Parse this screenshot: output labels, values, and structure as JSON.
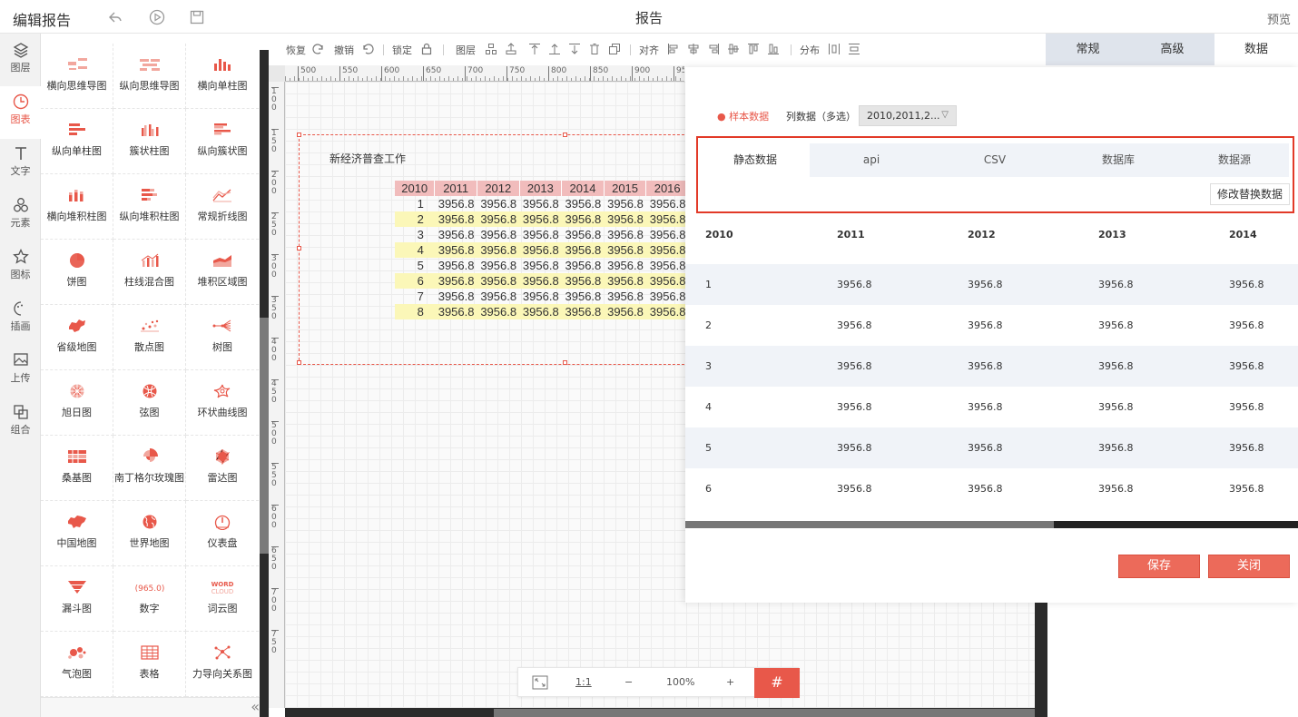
{
  "header": {
    "title": "编辑报告",
    "center_title": "报告",
    "preview": "预览"
  },
  "rail": [
    {
      "label": "图层",
      "icon": "layers-icon"
    },
    {
      "label": "图表",
      "icon": "chart-clock-icon",
      "active": true
    },
    {
      "label": "文字",
      "icon": "text-icon"
    },
    {
      "label": "元素",
      "icon": "shapes-icon"
    },
    {
      "label": "图标",
      "icon": "star-icon"
    },
    {
      "label": "插画",
      "icon": "palette-icon"
    },
    {
      "label": "上传",
      "icon": "upload-image-icon"
    },
    {
      "label": "组合",
      "icon": "group-icon"
    }
  ],
  "palette": [
    {
      "label": "横向思维导图",
      "icon": "mindmap-h-icon"
    },
    {
      "label": "纵向思维导图",
      "icon": "mindmap-v-icon"
    },
    {
      "label": "横向单柱图",
      "icon": "bar-v-icon"
    },
    {
      "label": "纵向单柱图",
      "icon": "bar-h-icon"
    },
    {
      "label": "簇状柱图",
      "icon": "cluster-bar-icon"
    },
    {
      "label": "纵向簇状图",
      "icon": "cluster-h-icon"
    },
    {
      "label": "横向堆积柱图",
      "icon": "stack-bar-icon"
    },
    {
      "label": "纵向堆积柱图",
      "icon": "stack-h-icon"
    },
    {
      "label": "常规折线图",
      "icon": "line-chart-icon"
    },
    {
      "label": "饼图",
      "icon": "pie-icon"
    },
    {
      "label": "柱线混合图",
      "icon": "bar-line-icon"
    },
    {
      "label": "堆积区域图",
      "icon": "area-icon"
    },
    {
      "label": "省级地图",
      "icon": "province-map-icon"
    },
    {
      "label": "散点图",
      "icon": "scatter-icon"
    },
    {
      "label": "树图",
      "icon": "tree-icon"
    },
    {
      "label": "旭日图",
      "icon": "sunburst-icon"
    },
    {
      "label": "弦图",
      "icon": "chord-icon"
    },
    {
      "label": "环状曲线图",
      "icon": "ring-curve-icon"
    },
    {
      "label": "桑基图",
      "icon": "sankey-icon"
    },
    {
      "label": "南丁格尔玫瑰图",
      "icon": "rose-icon"
    },
    {
      "label": "雷达图",
      "icon": "radar-icon"
    },
    {
      "label": "中国地图",
      "icon": "china-map-icon"
    },
    {
      "label": "世界地图",
      "icon": "world-map-icon"
    },
    {
      "label": "仪表盘",
      "icon": "gauge-icon"
    },
    {
      "label": "漏斗图",
      "icon": "funnel-icon"
    },
    {
      "label": "数字",
      "icon": "number-icon"
    },
    {
      "label": "词云图",
      "icon": "wordcloud-icon"
    },
    {
      "label": "气泡图",
      "icon": "bubble-icon"
    },
    {
      "label": "表格",
      "icon": "table-icon"
    },
    {
      "label": "力导向关系图",
      "icon": "force-graph-icon"
    }
  ],
  "number_icon_text": "965.0",
  "wordcloud_icon_text": [
    "WORD",
    "CLOUD"
  ],
  "toolbar": {
    "restore": "恢复",
    "undo": "撤销",
    "lock": "锁定",
    "layer": "图层",
    "align": "对齐",
    "distribute": "分布"
  },
  "ruler_labels": [
    "500",
    "550",
    "600",
    "650",
    "700",
    "750",
    "800",
    "850",
    "900",
    "950"
  ],
  "vruler_labels": [
    "100",
    "150",
    "200",
    "250",
    "300",
    "350",
    "400",
    "450",
    "500",
    "550",
    "600",
    "650",
    "700",
    "750"
  ],
  "widget": {
    "title": "新经济普查工作",
    "headers": [
      "2010",
      "2011",
      "2012",
      "2013",
      "2014",
      "2015",
      "2016"
    ],
    "rows": [
      [
        "1",
        "3956.8",
        "3956.8",
        "3956.8",
        "3956.8",
        "3956.8",
        "3956.8"
      ],
      [
        "2",
        "3956.8",
        "3956.8",
        "3956.8",
        "3956.8",
        "3956.8",
        "3956.8"
      ],
      [
        "3",
        "3956.8",
        "3956.8",
        "3956.8",
        "3956.8",
        "3956.8",
        "3956.8"
      ],
      [
        "4",
        "3956.8",
        "3956.8",
        "3956.8",
        "3956.8",
        "3956.8",
        "3956.8"
      ],
      [
        "5",
        "3956.8",
        "3956.8",
        "3956.8",
        "3956.8",
        "3956.8",
        "3956.8"
      ],
      [
        "6",
        "3956.8",
        "3956.8",
        "3956.8",
        "3956.8",
        "3956.8",
        "3956.8"
      ],
      [
        "7",
        "3956.8",
        "3956.8",
        "3956.8",
        "3956.8",
        "3956.8",
        "3956.8"
      ],
      [
        "8",
        "3956.8",
        "3956.8",
        "3956.8",
        "3956.8",
        "3956.8",
        "3956.8"
      ]
    ]
  },
  "zoom": {
    "one_to_one": "1:1",
    "minus": "−",
    "level": "100%",
    "plus": "+",
    "grid": "#"
  },
  "right_tabs": [
    "常规",
    "高级",
    "数据"
  ],
  "data_panel": {
    "sample": "● 样本数据",
    "col_data": "列数据（多选）",
    "col_select": "2010,2011,2...",
    "source_tabs": [
      "静态数据",
      "api",
      "CSV",
      "数据库",
      "数据源"
    ],
    "modify": "修改替换数据",
    "headers": [
      "2010",
      "2011",
      "2012",
      "2013",
      "2014"
    ],
    "rows": [
      [
        "1",
        "3956.8",
        "3956.8",
        "3956.8",
        "3956.8"
      ],
      [
        "2",
        "3956.8",
        "3956.8",
        "3956.8",
        "3956.8"
      ],
      [
        "3",
        "3956.8",
        "3956.8",
        "3956.8",
        "3956.8"
      ],
      [
        "4",
        "3956.8",
        "3956.8",
        "3956.8",
        "3956.8"
      ],
      [
        "5",
        "3956.8",
        "3956.8",
        "3956.8",
        "3956.8"
      ],
      [
        "6",
        "3956.8",
        "3956.8",
        "3956.8",
        "3956.8"
      ]
    ],
    "save": "保存",
    "close": "关闭"
  },
  "colors": {
    "accent": "#e8584a",
    "highlight_box": "#e23a28",
    "table_header": "#f1bcbc",
    "table_alt": "#fbf7b8"
  }
}
